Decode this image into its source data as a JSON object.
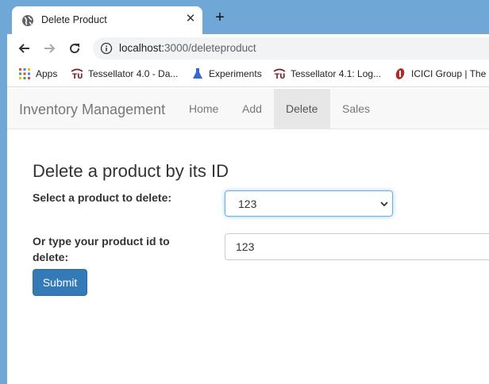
{
  "browser": {
    "tab_title": "Delete Product",
    "url_host": "localhost:",
    "url_rest": "3000/deleteproduct",
    "bookmarks": [
      {
        "label": "Apps",
        "icon": "apps-grid-icon"
      },
      {
        "label": "Tessellator 4.0 - Da...",
        "icon": "tu-logo-icon"
      },
      {
        "label": "Experiments",
        "icon": "flask-icon"
      },
      {
        "label": "Tessellator 4.1: Log...",
        "icon": "tu-logo-icon"
      },
      {
        "label": "ICICI Group | The L",
        "icon": "icici-logo-icon"
      }
    ]
  },
  "navbar": {
    "brand": "Inventory Management",
    "links": [
      {
        "label": "Home",
        "active": false
      },
      {
        "label": "Add",
        "active": false
      },
      {
        "label": "Delete",
        "active": true
      },
      {
        "label": "Sales",
        "active": false
      }
    ]
  },
  "form": {
    "heading": "Delete a product by its ID",
    "select_label": "Select a product to delete:",
    "select_value": "123",
    "text_label": "Or type your product id to delete:",
    "text_value": "123",
    "submit_label": "Submit"
  },
  "colors": {
    "window_blue": "#6fa8d6",
    "submit_blue": "#337ab7",
    "focus_blue": "#66afe9"
  }
}
